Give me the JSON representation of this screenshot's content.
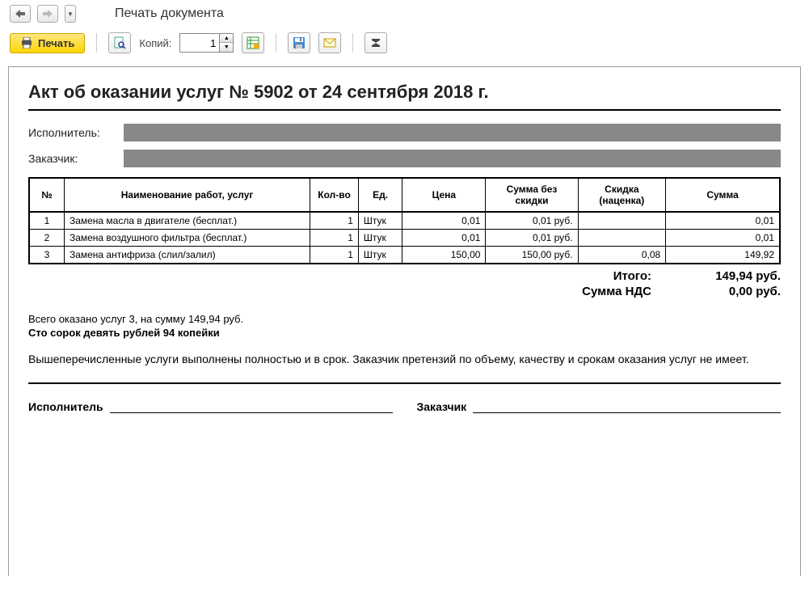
{
  "window": {
    "title": "Печать документа"
  },
  "toolbar": {
    "print_label": "Печать",
    "copies_label": "Копий:",
    "copies_value": "1"
  },
  "document": {
    "title": "Акт об оказании услуг № 5902 от 24 сентября 2018 г.",
    "executor_label": "Исполнитель:",
    "executor_value": "",
    "customer_label": "Заказчик:",
    "customer_value": "",
    "table": {
      "headers": {
        "num": "№",
        "name": "Наименование работ, услуг",
        "qty": "Кол-во",
        "unit": "Ед.",
        "price": "Цена",
        "sum_no_discount": "Сумма без скидки",
        "discount": "Скидка (наценка)",
        "sum": "Сумма"
      },
      "rows": [
        {
          "num": "1",
          "name": "Замена масла в двигателе (бесплат.)",
          "qty": "1",
          "unit": "Штук",
          "price": "0,01",
          "sum_no_discount": "0,01 руб.",
          "discount": "",
          "sum": "0,01"
        },
        {
          "num": "2",
          "name": "Замена воздушного фильтра (бесплат.)",
          "qty": "1",
          "unit": "Штук",
          "price": "0,01",
          "sum_no_discount": "0,01 руб.",
          "discount": "",
          "sum": "0,01"
        },
        {
          "num": "3",
          "name": "Замена антифриза (слил/залил)",
          "qty": "1",
          "unit": "Штук",
          "price": "150,00",
          "sum_no_discount": "150,00 руб.",
          "discount": "0,08",
          "sum": "149,92"
        }
      ]
    },
    "totals": {
      "total_label": "Итого:",
      "total_value": "149,94 руб.",
      "vat_label": "Сумма НДС",
      "vat_value": "0,00 руб."
    },
    "summary": {
      "line1": "Всего оказано услуг 3, на сумму 149,94 руб.",
      "line2": "Сто сорок девять рублей 94 копейки"
    },
    "disclaimer": "Вышеперечисленные услуги выполнены полностью и в срок. Заказчик претензий по объему, качеству и срокам оказания услуг не имеет.",
    "signatures": {
      "executor": "Исполнитель",
      "customer": "Заказчик"
    }
  }
}
